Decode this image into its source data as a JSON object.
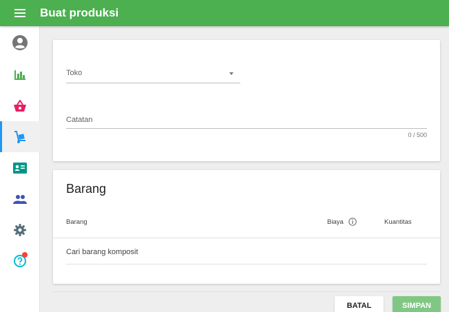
{
  "appbar": {
    "title": "Buat produksi",
    "menu_icon": "menu-icon"
  },
  "sidebar": {
    "items": [
      {
        "name": "account",
        "icon": "account-circle-icon",
        "color": "#757575"
      },
      {
        "name": "reports",
        "icon": "bar-chart-icon",
        "color": "#4caf50"
      },
      {
        "name": "sales",
        "icon": "basket-icon",
        "color": "#e91e63"
      },
      {
        "name": "inventory",
        "icon": "dolly-icon",
        "color": "#2196f3",
        "active": true
      },
      {
        "name": "contacts",
        "icon": "id-card-icon",
        "color": "#009688"
      },
      {
        "name": "employees",
        "icon": "people-icon",
        "color": "#3f51b5"
      },
      {
        "name": "settings",
        "icon": "gear-icon",
        "color": "#546e7a"
      },
      {
        "name": "help",
        "icon": "help-icon",
        "color": "#00bcd4",
        "badge": true
      }
    ]
  },
  "form": {
    "toko_label": "Toko",
    "catatan_label": "Catatan",
    "catatan_counter": "0 / 500"
  },
  "items_section": {
    "title": "Barang",
    "columns": {
      "barang": "Barang",
      "biaya": "Biaya",
      "kuantitas": "Kuantitas"
    },
    "search_placeholder": "Cari barang komposit"
  },
  "actions": {
    "cancel": "BATAL",
    "save": "SIMPAN"
  },
  "colors": {
    "primary": "#4caf50",
    "save_button": "#81c784",
    "active_indicator": "#2196f3"
  }
}
